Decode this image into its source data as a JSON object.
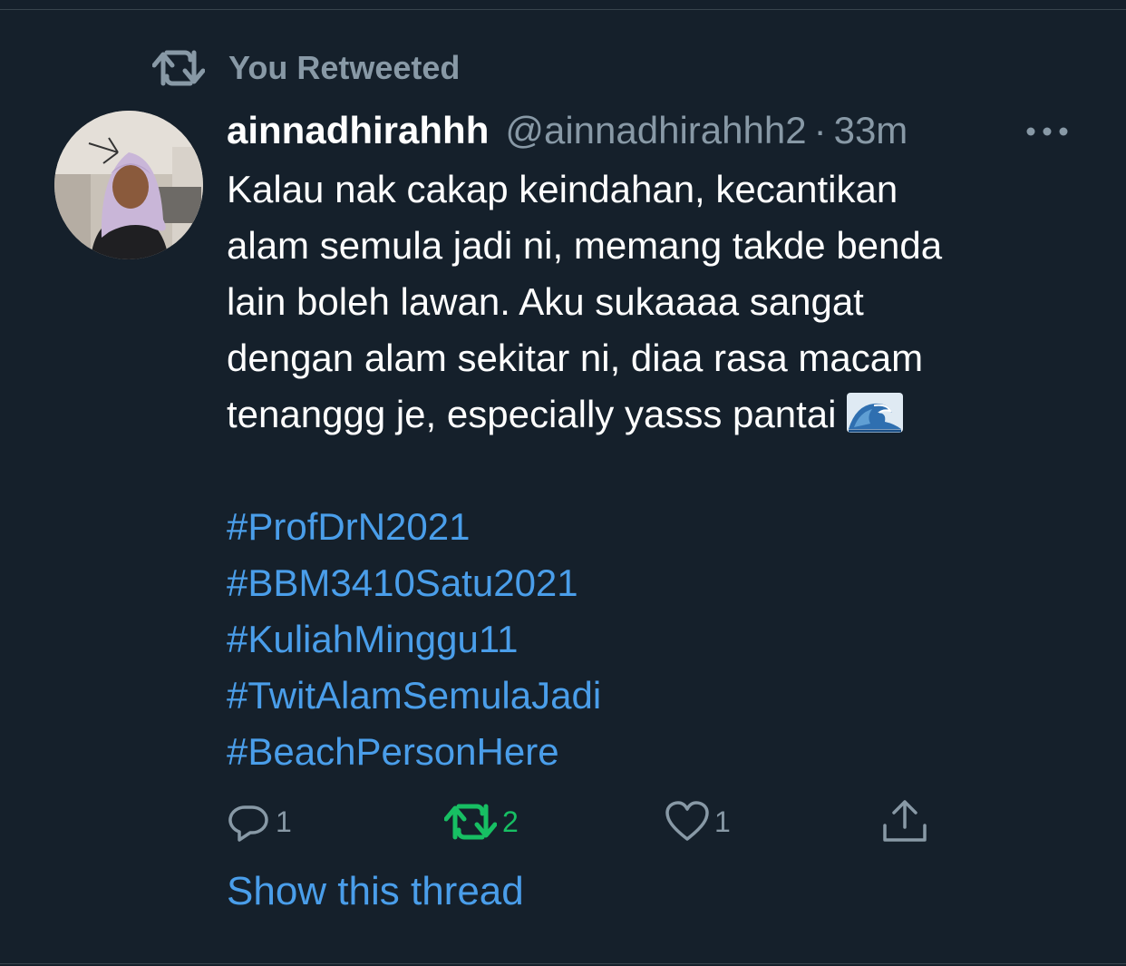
{
  "retweet_header": {
    "label": "You Retweeted"
  },
  "tweet": {
    "display_name": "ainnadhirahhh",
    "handle": "@ainnadhirahhh2",
    "separator": "·",
    "time": "33m",
    "text_lines": [
      "Kalau nak cakap keindahan, kecantikan",
      "alam semula jadi ni, memang takde benda",
      "lain boleh lawan. Aku sukaaaa sangat",
      "dengan alam sekitar ni, diaa rasa macam",
      "tenanggg je, especially yasss pantai"
    ],
    "emoji": "wave-emoji",
    "hashtags": [
      "#ProfDrN2021",
      "#BBM3410Satu2021",
      "#KuliahMinggu11",
      "#TwitAlamSemulaJadi",
      "#BeachPersonHere"
    ],
    "actions": {
      "reply_count": "1",
      "retweet_count": "2",
      "like_count": "1"
    },
    "show_thread": "Show this thread"
  },
  "colors": {
    "background": "#15202b",
    "secondary_text": "#8899a6",
    "link": "#4a9eea",
    "retweet_active": "#17bf63"
  }
}
